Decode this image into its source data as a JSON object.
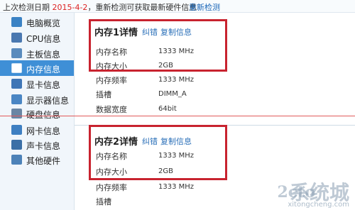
{
  "topbar": {
    "last_check_label": "上次检测日期",
    "last_check_date": "2015-4-2",
    "notice": "，重新检测可获取最新硬件信息",
    "recheck_link": "重新检测"
  },
  "sidebar": {
    "items": [
      {
        "label": "电脑概览",
        "icon": "computer-icon",
        "color": "#3b82c4"
      },
      {
        "label": "CPU信息",
        "icon": "cpu-icon",
        "color": "#4a78b0"
      },
      {
        "label": "主板信息",
        "icon": "motherboard-icon",
        "color": "#5a8bbd"
      },
      {
        "label": "内存信息",
        "icon": "memory-icon",
        "color": "#ffffff"
      },
      {
        "label": "显卡信息",
        "icon": "graphics-card-icon",
        "color": "#3f76b6"
      },
      {
        "label": "显示器信息",
        "icon": "monitor-icon",
        "color": "#4a86c4"
      },
      {
        "label": "硬盘信息",
        "icon": "harddisk-icon",
        "color": "#6a86a4"
      },
      {
        "label": "网卡信息",
        "icon": "network-card-icon",
        "color": "#3e7fc2"
      },
      {
        "label": "声卡信息",
        "icon": "sound-card-icon",
        "color": "#3b6fa6"
      },
      {
        "label": "其他硬件",
        "icon": "other-hardware-icon",
        "color": "#4d82b8"
      }
    ],
    "active_index": 3
  },
  "memory1": {
    "title": "内存1详情",
    "report_link": "纠错",
    "copy_link": "复制信息",
    "rows": [
      {
        "key": "内存名称",
        "value": "1333 MHz"
      },
      {
        "key": "内存大小",
        "value": "2GB"
      },
      {
        "key": "内存频率",
        "value": "1333 MHz"
      },
      {
        "key": "插槽",
        "value": "DIMM_A"
      },
      {
        "key": "数据宽度",
        "value": "64bit"
      }
    ]
  },
  "memory2": {
    "title": "内存2详情",
    "report_link": "纠错",
    "copy_link": "复制信息",
    "rows": [
      {
        "key": "内存名称",
        "value": "1333 MHz"
      },
      {
        "key": "内存大小",
        "value": "2GB"
      },
      {
        "key": "内存频率",
        "value": "1333 MHz"
      },
      {
        "key": "插槽",
        "value": ""
      }
    ]
  },
  "watermark": {
    "mark": "2cto",
    "text": "系统城",
    "sub": "xitongcheng.com"
  },
  "colors": {
    "accent": "#3f8fd6",
    "link": "#2a6fb8",
    "highlight": "#c8232f",
    "date": "#d22222"
  }
}
